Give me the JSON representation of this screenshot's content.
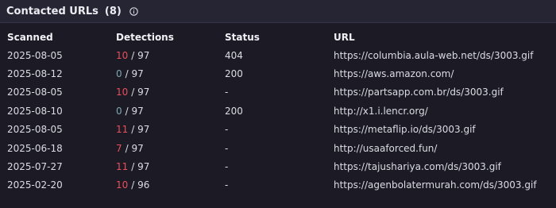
{
  "header": {
    "title": "Contacted URLs",
    "count": "(8)",
    "info_icon": "info-icon"
  },
  "table": {
    "columns": [
      "Scanned",
      "Detections",
      "Status",
      "URL"
    ],
    "rows": [
      {
        "scanned": "2025-08-05",
        "detected": "10",
        "total": "/ 97",
        "status": "404",
        "url": "https://columbia.aula-web.net/ds/3003.gif"
      },
      {
        "scanned": "2025-08-12",
        "detected": "0",
        "total": "/ 97",
        "status": "200",
        "url": "https://aws.amazon.com/"
      },
      {
        "scanned": "2025-08-05",
        "detected": "10",
        "total": "/ 97",
        "status": "-",
        "url": "https://partsapp.com.br/ds/3003.gif"
      },
      {
        "scanned": "2025-08-10",
        "detected": "0",
        "total": "/ 97",
        "status": "200",
        "url": "http://x1.i.lencr.org/"
      },
      {
        "scanned": "2025-08-05",
        "detected": "11",
        "total": "/ 97",
        "status": "-",
        "url": "https://metaflip.io/ds/3003.gif"
      },
      {
        "scanned": "2025-06-18",
        "detected": "7",
        "total": "/ 97",
        "status": "-",
        "url": "http://usaaforced.fun/"
      },
      {
        "scanned": "2025-07-27",
        "detected": "11",
        "total": "/ 97",
        "status": "-",
        "url": "https://tajushariya.com/ds/3003.gif"
      },
      {
        "scanned": "2025-02-20",
        "detected": "10",
        "total": "/ 96",
        "status": "-",
        "url": "https://agenbolatermurah.com/ds/3003.gif"
      }
    ]
  },
  "colors": {
    "background": "#1b1a25",
    "header_background": "#262533",
    "malicious": "#e8505b",
    "clean": "#7fa7b0"
  }
}
